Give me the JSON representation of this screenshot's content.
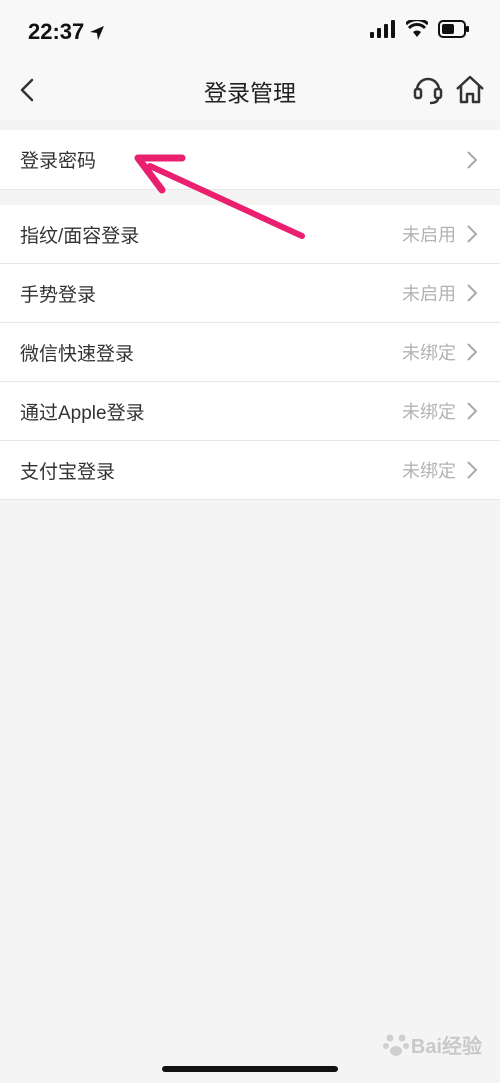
{
  "status_bar": {
    "time": "22:37"
  },
  "nav": {
    "title": "登录管理"
  },
  "groups": [
    {
      "rows": [
        {
          "label": "登录密码",
          "value": ""
        }
      ]
    },
    {
      "rows": [
        {
          "label": "指纹/面容登录",
          "value": "未启用"
        },
        {
          "label": "手势登录",
          "value": "未启用"
        },
        {
          "label": "微信快速登录",
          "value": "未绑定"
        },
        {
          "label": "通过Apple登录",
          "value": "未绑定"
        },
        {
          "label": "支付宝登录",
          "value": "未绑定"
        }
      ]
    }
  ],
  "watermark": {
    "text": "Bai经验"
  },
  "colors": {
    "annotation_arrow": "#ea1f6f"
  }
}
